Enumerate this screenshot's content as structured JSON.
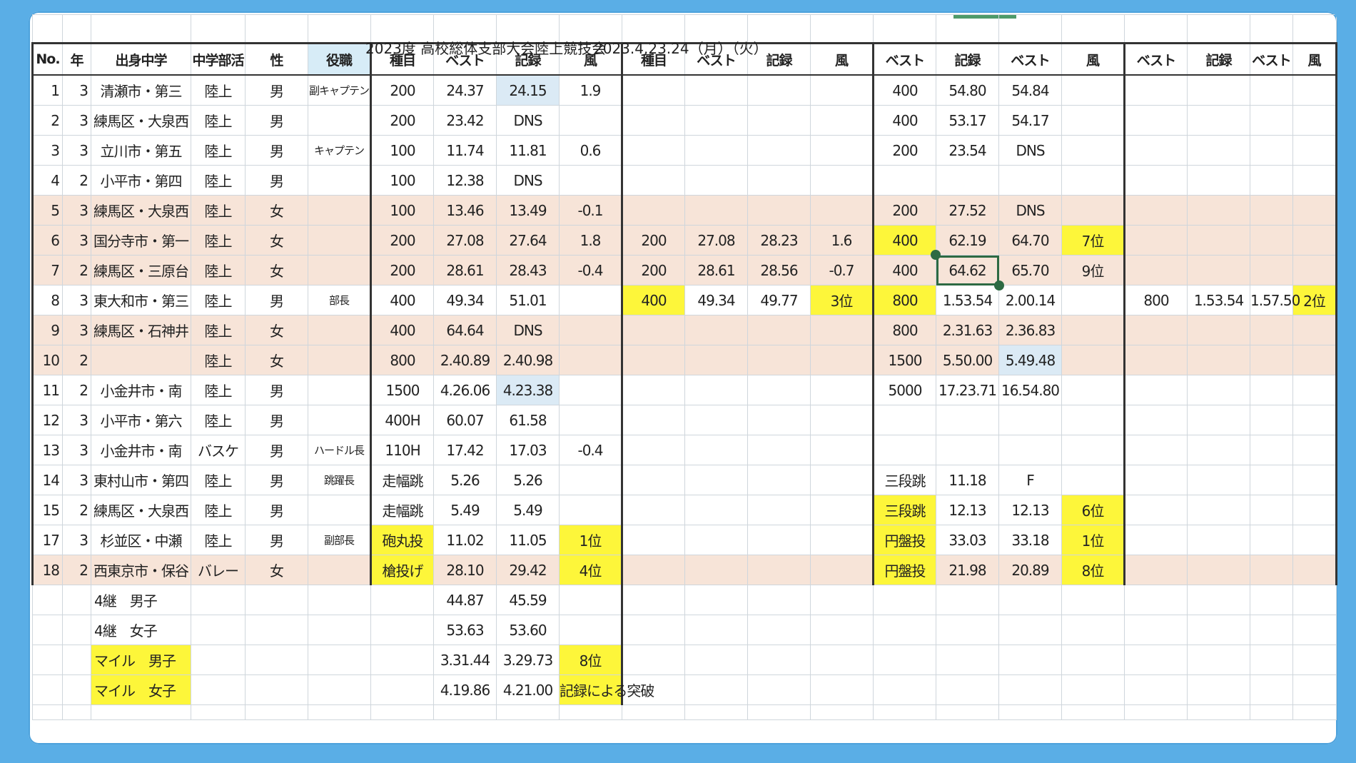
{
  "title": {
    "event": "2023度 高校総体支部大会陸上競技会",
    "date": "2023.4.23.24（月）（火）"
  },
  "headers": [
    "No.",
    "年",
    "出身中学",
    "中学部活",
    "性",
    "役職",
    "種目",
    "ベスト",
    "記録",
    "風",
    "種目",
    "ベスト",
    "記録",
    "風",
    "ベスト",
    "記録",
    "ベスト",
    "風",
    "ベスト",
    "記録",
    "ベスト",
    "風"
  ],
  "rows": [
    {
      "no": "1",
      "grade": "3",
      "school": "清瀬市・第三",
      "club": "陸上",
      "sex": "男",
      "role": "副キャプテン",
      "ev1": "200",
      "best1": "24.37",
      "rec1": "24.15",
      "wind1": "1.9",
      "ev2": "",
      "best2": "",
      "rec2": "",
      "wind2": "",
      "ev3": "400",
      "rec3": "54.80",
      "best3": "54.84",
      "wind3": "",
      "c19": "",
      "c20": "",
      "c21": "",
      "c22": ""
    },
    {
      "no": "2",
      "grade": "3",
      "school": "練馬区・大泉西",
      "club": "陸上",
      "sex": "男",
      "role": "",
      "ev1": "200",
      "best1": "23.42",
      "rec1": "DNS",
      "wind1": "",
      "ev2": "",
      "best2": "",
      "rec2": "",
      "wind2": "",
      "ev3": "400",
      "rec3": "53.17",
      "best3": "54.17",
      "wind3": "",
      "c19": "",
      "c20": "",
      "c21": "",
      "c22": ""
    },
    {
      "no": "3",
      "grade": "3",
      "school": "立川市・第五",
      "club": "陸上",
      "sex": "男",
      "role": "キャプテン",
      "ev1": "100",
      "best1": "11.74",
      "rec1": "11.81",
      "wind1": "0.6",
      "ev2": "",
      "best2": "",
      "rec2": "",
      "wind2": "",
      "ev3": "200",
      "rec3": "23.54",
      "best3": "DNS",
      "wind3": "",
      "c19": "",
      "c20": "",
      "c21": "",
      "c22": ""
    },
    {
      "no": "4",
      "grade": "2",
      "school": "小平市・第四",
      "club": "陸上",
      "sex": "男",
      "role": "",
      "ev1": "100",
      "best1": "12.38",
      "rec1": "DNS",
      "wind1": "",
      "ev2": "",
      "best2": "",
      "rec2": "",
      "wind2": "",
      "ev3": "",
      "rec3": "",
      "best3": "",
      "wind3": "",
      "c19": "",
      "c20": "",
      "c21": "",
      "c22": ""
    },
    {
      "no": "5",
      "grade": "3",
      "school": "練馬区・大泉西",
      "club": "陸上",
      "sex": "女",
      "role": "",
      "ev1": "100",
      "best1": "13.46",
      "rec1": "13.49",
      "wind1": "-0.1",
      "ev2": "",
      "best2": "",
      "rec2": "",
      "wind2": "",
      "ev3": "200",
      "rec3": "27.52",
      "best3": "DNS",
      "wind3": "",
      "c19": "",
      "c20": "",
      "c21": "",
      "c22": ""
    },
    {
      "no": "6",
      "grade": "3",
      "school": "国分寺市・第一",
      "club": "陸上",
      "sex": "女",
      "role": "",
      "ev1": "200",
      "best1": "27.08",
      "rec1": "27.64",
      "wind1": "1.8",
      "ev2": "200",
      "best2": "27.08",
      "rec2": "28.23",
      "wind2": "1.6",
      "ev3": "400",
      "rec3": "62.19",
      "best3": "64.70",
      "wind3": "7位",
      "c19": "",
      "c20": "",
      "c21": "",
      "c22": ""
    },
    {
      "no": "7",
      "grade": "2",
      "school": "練馬区・三原台",
      "club": "陸上",
      "sex": "女",
      "role": "",
      "ev1": "200",
      "best1": "28.61",
      "rec1": "28.43",
      "wind1": "-0.4",
      "ev2": "200",
      "best2": "28.61",
      "rec2": "28.56",
      "wind2": "-0.7",
      "ev3": "400",
      "rec3": "64.62",
      "best3": "65.70",
      "wind3": "9位",
      "c19": "",
      "c20": "",
      "c21": "",
      "c22": ""
    },
    {
      "no": "8",
      "grade": "3",
      "school": "東大和市・第三",
      "club": "陸上",
      "sex": "男",
      "role": "部長",
      "ev1": "400",
      "best1": "49.34",
      "rec1": "51.01",
      "wind1": "",
      "ev2": "400",
      "best2": "49.34",
      "rec2": "49.77",
      "wind2": "3位",
      "ev3": "800",
      "rec3": "1.53.54",
      "best3": "2.00.14",
      "wind3": "",
      "c19": "800",
      "c20": "1.53.54",
      "c21": "1.57.50",
      "c22": "2位"
    },
    {
      "no": "9",
      "grade": "3",
      "school": "練馬区・石神井",
      "club": "陸上",
      "sex": "女",
      "role": "",
      "ev1": "400",
      "best1": "64.64",
      "rec1": "DNS",
      "wind1": "",
      "ev2": "",
      "best2": "",
      "rec2": "",
      "wind2": "",
      "ev3": "800",
      "rec3": "2.31.63",
      "best3": "2.36.83",
      "wind3": "",
      "c19": "",
      "c20": "",
      "c21": "",
      "c22": ""
    },
    {
      "no": "10",
      "grade": "2",
      "school": "",
      "club": "陸上",
      "sex": "女",
      "role": "",
      "ev1": "800",
      "best1": "2.40.89",
      "rec1": "2.40.98",
      "wind1": "",
      "ev2": "",
      "best2": "",
      "rec2": "",
      "wind2": "",
      "ev3": "1500",
      "rec3": "5.50.00",
      "best3": "5.49.48",
      "wind3": "",
      "c19": "",
      "c20": "",
      "c21": "",
      "c22": ""
    },
    {
      "no": "11",
      "grade": "2",
      "school": "小金井市・南",
      "club": "陸上",
      "sex": "男",
      "role": "",
      "ev1": "1500",
      "best1": "4.26.06",
      "rec1": "4.23.38",
      "wind1": "",
      "ev2": "",
      "best2": "",
      "rec2": "",
      "wind2": "",
      "ev3": "5000",
      "rec3": "17.23.71",
      "best3": "16.54.80",
      "wind3": "",
      "c19": "",
      "c20": "",
      "c21": "",
      "c22": ""
    },
    {
      "no": "12",
      "grade": "3",
      "school": "小平市・第六",
      "club": "陸上",
      "sex": "男",
      "role": "",
      "ev1": "400H",
      "best1": "60.07",
      "rec1": "61.58",
      "wind1": "",
      "ev2": "",
      "best2": "",
      "rec2": "",
      "wind2": "",
      "ev3": "",
      "rec3": "",
      "best3": "",
      "wind3": "",
      "c19": "",
      "c20": "",
      "c21": "",
      "c22": ""
    },
    {
      "no": "13",
      "grade": "3",
      "school": "小金井市・南",
      "club": "バスケ",
      "sex": "男",
      "role": "ハードル長",
      "ev1": "110H",
      "best1": "17.42",
      "rec1": "17.03",
      "wind1": "-0.4",
      "ev2": "",
      "best2": "",
      "rec2": "",
      "wind2": "",
      "ev3": "",
      "rec3": "",
      "best3": "",
      "wind3": "",
      "c19": "",
      "c20": "",
      "c21": "",
      "c22": ""
    },
    {
      "no": "14",
      "grade": "3",
      "school": "東村山市・第四",
      "club": "陸上",
      "sex": "男",
      "role": "跳躍長",
      "ev1": "走幅跳",
      "best1": "5.26",
      "rec1": "5.26",
      "wind1": "",
      "ev2": "",
      "best2": "",
      "rec2": "",
      "wind2": "",
      "ev3": "三段跳",
      "rec3": "11.18",
      "best3": "F",
      "wind3": "",
      "c19": "",
      "c20": "",
      "c21": "",
      "c22": ""
    },
    {
      "no": "15",
      "grade": "2",
      "school": "練馬区・大泉西",
      "club": "陸上",
      "sex": "男",
      "role": "",
      "ev1": "走幅跳",
      "best1": "5.49",
      "rec1": "5.49",
      "wind1": "",
      "ev2": "",
      "best2": "",
      "rec2": "",
      "wind2": "",
      "ev3": "三段跳",
      "rec3": "12.13",
      "best3": "12.13",
      "wind3": "6位",
      "c19": "",
      "c20": "",
      "c21": "",
      "c22": ""
    },
    {
      "no": "17",
      "grade": "3",
      "school": "杉並区・中瀬",
      "club": "陸上",
      "sex": "男",
      "role": "副部長",
      "ev1": "砲丸投",
      "best1": "11.02",
      "rec1": "11.05",
      "wind1": "1位",
      "ev2": "",
      "best2": "",
      "rec2": "",
      "wind2": "",
      "ev3": "円盤投",
      "rec3": "33.03",
      "best3": "33.18",
      "wind3": "1位",
      "c19": "",
      "c20": "",
      "c21": "",
      "c22": ""
    },
    {
      "no": "18",
      "grade": "2",
      "school": "西東京市・保谷",
      "club": "バレー",
      "sex": "女",
      "role": "",
      "ev1": "槍投げ",
      "best1": "28.10",
      "rec1": "29.42",
      "wind1": "4位",
      "ev2": "",
      "best2": "",
      "rec2": "",
      "wind2": "",
      "ev3": "円盤投",
      "rec3": "21.98",
      "best3": "20.89",
      "wind3": "8位",
      "c19": "",
      "c20": "",
      "c21": "",
      "c22": ""
    }
  ],
  "relays": [
    {
      "label": "4継　男子",
      "best": "44.87",
      "rec": "45.59",
      "rank": ""
    },
    {
      "label": "4継　女子",
      "best": "53.63",
      "rec": "53.60",
      "rank": ""
    },
    {
      "label": "マイル　男子",
      "best": "3.31.44",
      "rec": "3.29.73",
      "rank": "8位"
    },
    {
      "label": "マイル　女子",
      "best": "4.19.86",
      "rec": "4.21.00",
      "rank": "記録による突破"
    }
  ],
  "colors": {
    "background": "#5aaee6",
    "highlight_yellow": "#fdf63a",
    "row_pink": "#f7e4d8",
    "cell_blue": "#dbeaf5",
    "selection_green": "#2d6a43"
  }
}
